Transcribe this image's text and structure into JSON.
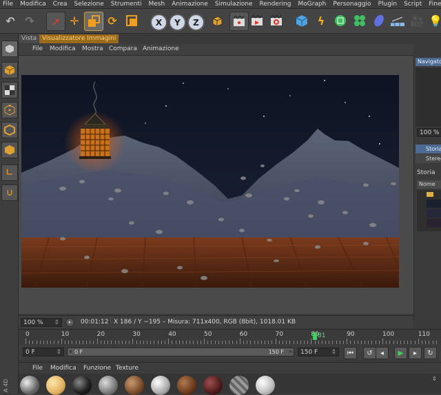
{
  "menu": [
    "File",
    "Modifica",
    "Crea",
    "Selezione",
    "Strumenti",
    "Mesh",
    "Animazione",
    "Simulazione",
    "Rendering",
    "MoGraph",
    "Personaggio",
    "Plugin",
    "Script",
    "Finestre"
  ],
  "toolbar": {
    "axes": [
      "X",
      "Y",
      "Z"
    ]
  },
  "tabs": [
    "Vista",
    "Visualizzatore Immagini"
  ],
  "viewer_menu": [
    "File",
    "Modifica",
    "Mostra",
    "Compara",
    "Animazione"
  ],
  "info": {
    "zoom": "100 %",
    "time": "00:01:12",
    "details": "X 186 / Y −195 – Misura: 711x400, RGB (8bit), 1018.01 KB"
  },
  "right_panel": {
    "navigator": "Navigato",
    "zoom": "100 %",
    "tab_storia": "Storia",
    "tab_stereo": "Stereo",
    "section_storia": "Storia",
    "col_nome": "Nome"
  },
  "timeline": {
    "ticks": [
      "0",
      "10",
      "20",
      "30",
      "40",
      "50",
      "60",
      "70",
      "80",
      "90",
      "100",
      "110"
    ],
    "current_frame": "81",
    "start_field": "0 F",
    "range_start": "0 F",
    "range_end": "150 F",
    "end_field": "150 F"
  },
  "material_menu": [
    "File",
    "Modifica",
    "Funzione",
    "Texture"
  ],
  "side_label": "A 4D",
  "colors": {
    "accent": "#f0a020",
    "sky": "#141a2c",
    "floor": "#7a3a1e"
  }
}
